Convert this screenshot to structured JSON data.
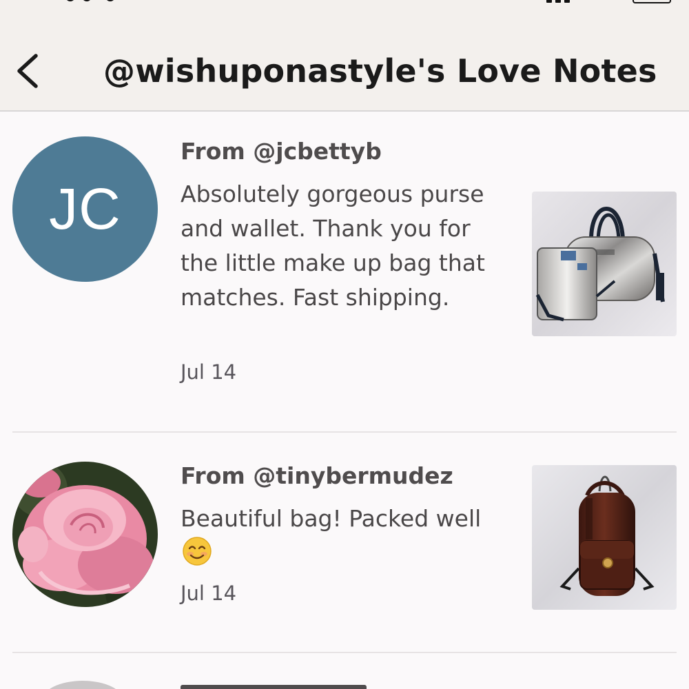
{
  "header": {
    "title": "@wishuponastyle's Love Notes",
    "back_icon": "chevron-left-icon"
  },
  "colors": {
    "header_bg": "#f3f0ed",
    "page_bg": "#fbf9fa",
    "avatar_jc": "#4e7b95",
    "text_primary": "#4a4748"
  },
  "notes": [
    {
      "from": "From @jcbettyb",
      "avatar_initials": "JC",
      "text": "Absolutely gorgeous purse and wallet. Thank you for the little make up bag that matches. Fast shipping.",
      "date": "Jul 14",
      "thumbnail": "silver-monogram-purse-and-wallet-photo"
    },
    {
      "from": "From @tinybermudez",
      "avatar": "pink-rose-avatar",
      "text": "Beautiful bag! Packed well",
      "emoji": "smiling-face-icon",
      "date": "Jul 14",
      "thumbnail": "brown-leather-backpack-photo"
    }
  ]
}
